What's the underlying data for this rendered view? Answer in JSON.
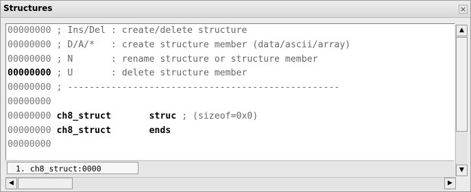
{
  "window": {
    "title": "Structures",
    "close_glyph": "×"
  },
  "lines": [
    {
      "addr": "00000000",
      "text": " ; Ins/Del : create/delete structure"
    },
    {
      "addr": "00000000",
      "text": " ; D/A/*   : create structure member (data/ascii/array)"
    },
    {
      "addr": "00000000",
      "text": " ; N       : rename structure or structure member"
    },
    {
      "addr": "00000000",
      "text": " ; U       : delete structure member"
    },
    {
      "addr": "00000000",
      "text": " ; --------------------------------------------------"
    },
    {
      "addr": "00000000",
      "text": ""
    }
  ],
  "struct_line": {
    "addr": "00000000",
    "name": "ch8_struct",
    "keyword": "struc",
    "comment": " ; (sizeof=0x0)"
  },
  "ends_line": {
    "addr": "00000000",
    "name": "ch8_struct",
    "keyword": "ends"
  },
  "last_line": {
    "addr": "00000000"
  },
  "tab": {
    "label": "1. ch8_struct:0000"
  },
  "icons": {
    "up": "scroll-up-icon",
    "down": "scroll-down-icon",
    "left": "scroll-left-icon",
    "right": "scroll-right-icon"
  }
}
